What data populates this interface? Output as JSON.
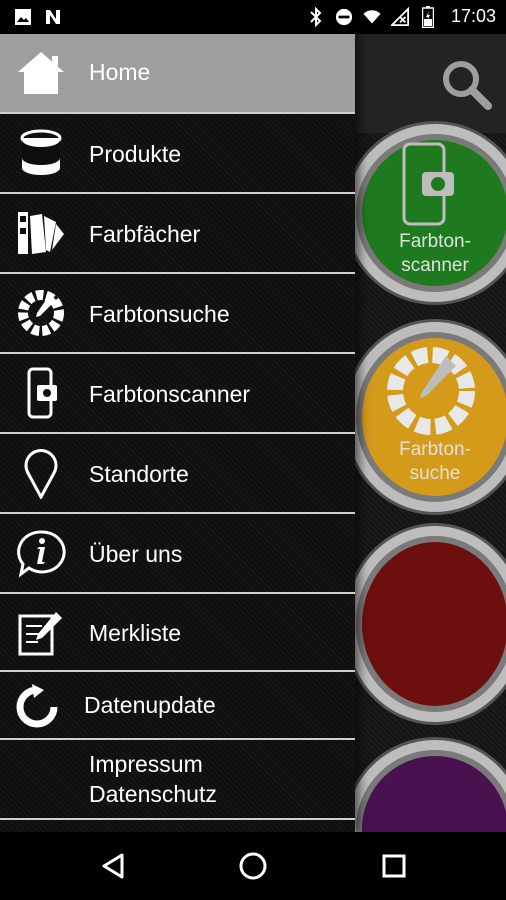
{
  "status_bar": {
    "time": "17:03",
    "icons": [
      "image-icon",
      "n-icon",
      "bluetooth-icon",
      "do-not-disturb-icon",
      "wifi-icon",
      "no-signal-icon",
      "battery-charging-icon"
    ]
  },
  "app": {
    "search_icon": "search-icon",
    "paint_cans": [
      {
        "label_line1": "Farbton-",
        "label_line2": "scanner",
        "color": "#1f7a1f"
      },
      {
        "label_line1": "Farbton-",
        "label_line2": "suche",
        "color": "#d49a1a"
      },
      {
        "label_line1": "",
        "label_line2": "",
        "color": "#6e0f0f"
      },
      {
        "label_line1": "",
        "label_line2": "",
        "color": "#4a1150"
      }
    ]
  },
  "drawer": {
    "items": [
      {
        "label": "Home",
        "icon": "home-icon",
        "active": true
      },
      {
        "label": "Produkte",
        "icon": "paint-bucket-icon"
      },
      {
        "label": "Farbfächer",
        "icon": "color-fan-icon"
      },
      {
        "label": "Farbtonsuche",
        "icon": "color-wheel-icon"
      },
      {
        "label": "Farbtonscanner",
        "icon": "phone-camera-icon"
      },
      {
        "label": "Standorte",
        "icon": "location-pin-icon"
      },
      {
        "label": "Über uns",
        "icon": "info-bubble-icon"
      },
      {
        "label": "Merkliste",
        "icon": "notepad-pen-icon"
      },
      {
        "label": "Datenupdate",
        "icon": "refresh-icon"
      },
      {
        "label_line1": "Impressum",
        "label_line2": "Datenschutz"
      }
    ]
  },
  "nav_bar": {
    "back": "back-icon",
    "home": "home-circle-icon",
    "recents": "recents-icon"
  },
  "colors": {
    "active_item_bg": "#9e9e9e",
    "divider": "#cfcfcf"
  }
}
